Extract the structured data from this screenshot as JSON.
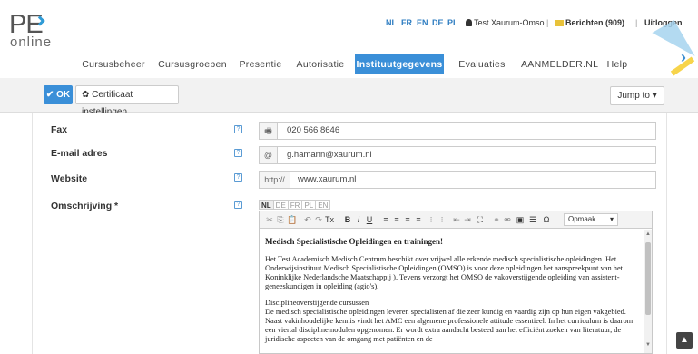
{
  "logo": {
    "pe": "PE",
    "online": "online"
  },
  "header": {
    "languages": [
      "NL",
      "FR",
      "EN",
      "DE",
      "PL"
    ],
    "user": "Test Xaurum-Omso",
    "messages": "Berichten (909)",
    "logout": "Uitloggen",
    "separator": "|"
  },
  "nav": [
    {
      "label": "Cursusbeheer"
    },
    {
      "label": "Cursusgroepen"
    },
    {
      "label": "Presentie"
    },
    {
      "label": "Autorisatie"
    },
    {
      "label": "Instituutgegevens",
      "active": true
    },
    {
      "label": "Evaluaties"
    },
    {
      "label": "AANMELDER.NL"
    },
    {
      "label": "Help"
    }
  ],
  "toolbar": {
    "ok_label": "✔ OK",
    "cert_label": "✿ Certificaat instellingen",
    "jump_label": "Jump to ▾"
  },
  "form": {
    "fax": {
      "label": "Fax",
      "addon": "🖷",
      "value": "020 566 8646"
    },
    "email": {
      "label": "E-mail adres",
      "addon": "@",
      "value": "g.hamann@xaurum.nl"
    },
    "website": {
      "label": "Website",
      "addon": "http://",
      "value": "www.xaurum.nl"
    },
    "description": {
      "label": "Omschrijving *",
      "lang_tabs": [
        "NL",
        "DE",
        "FR",
        "PL",
        "EN"
      ],
      "format_select": "Opmaak",
      "heading": "Medisch Specialistische Opleidingen en trainingen!",
      "paragraph1": "Het Test Academisch Medisch Centrum beschikt over vrijwel alle erkende medisch specialistische opleidingen. Het Onderwijsinstituut Medisch Specialistische Opleidingen (OMSO) is voor deze opleidingen het aanspreekpunt van het Koninklijke Nederlandsche Maatschappij ). Tevens verzorgt het OMSO de vakoverstijgende opleiding van assistent-geneeskundigen in opleiding (agio's).",
      "paragraph2_title": "Disciplineoverstijgende cursussen",
      "paragraph2": "De medisch specialistische opleidingen leveren specialisten af die zeer kundig en vaardig zijn op hun eigen vakgebied. Naast vakinhoudelijke kennis vindt het AMC een algemene professionele attitude essentieel. In het curriculum is daarom een viertal disciplinemodulen opgenomen. Er wordt extra aandacht besteed aan het efficiënt zoeken van literatuur, de juridische aspecten van de omgang met patiënten en de"
    },
    "help_glyph": "?"
  },
  "colors": {
    "accent": "#3a8fd8",
    "toolbar_bg": "#f2f2f2"
  },
  "icons": {
    "scroll_top": "▲"
  }
}
